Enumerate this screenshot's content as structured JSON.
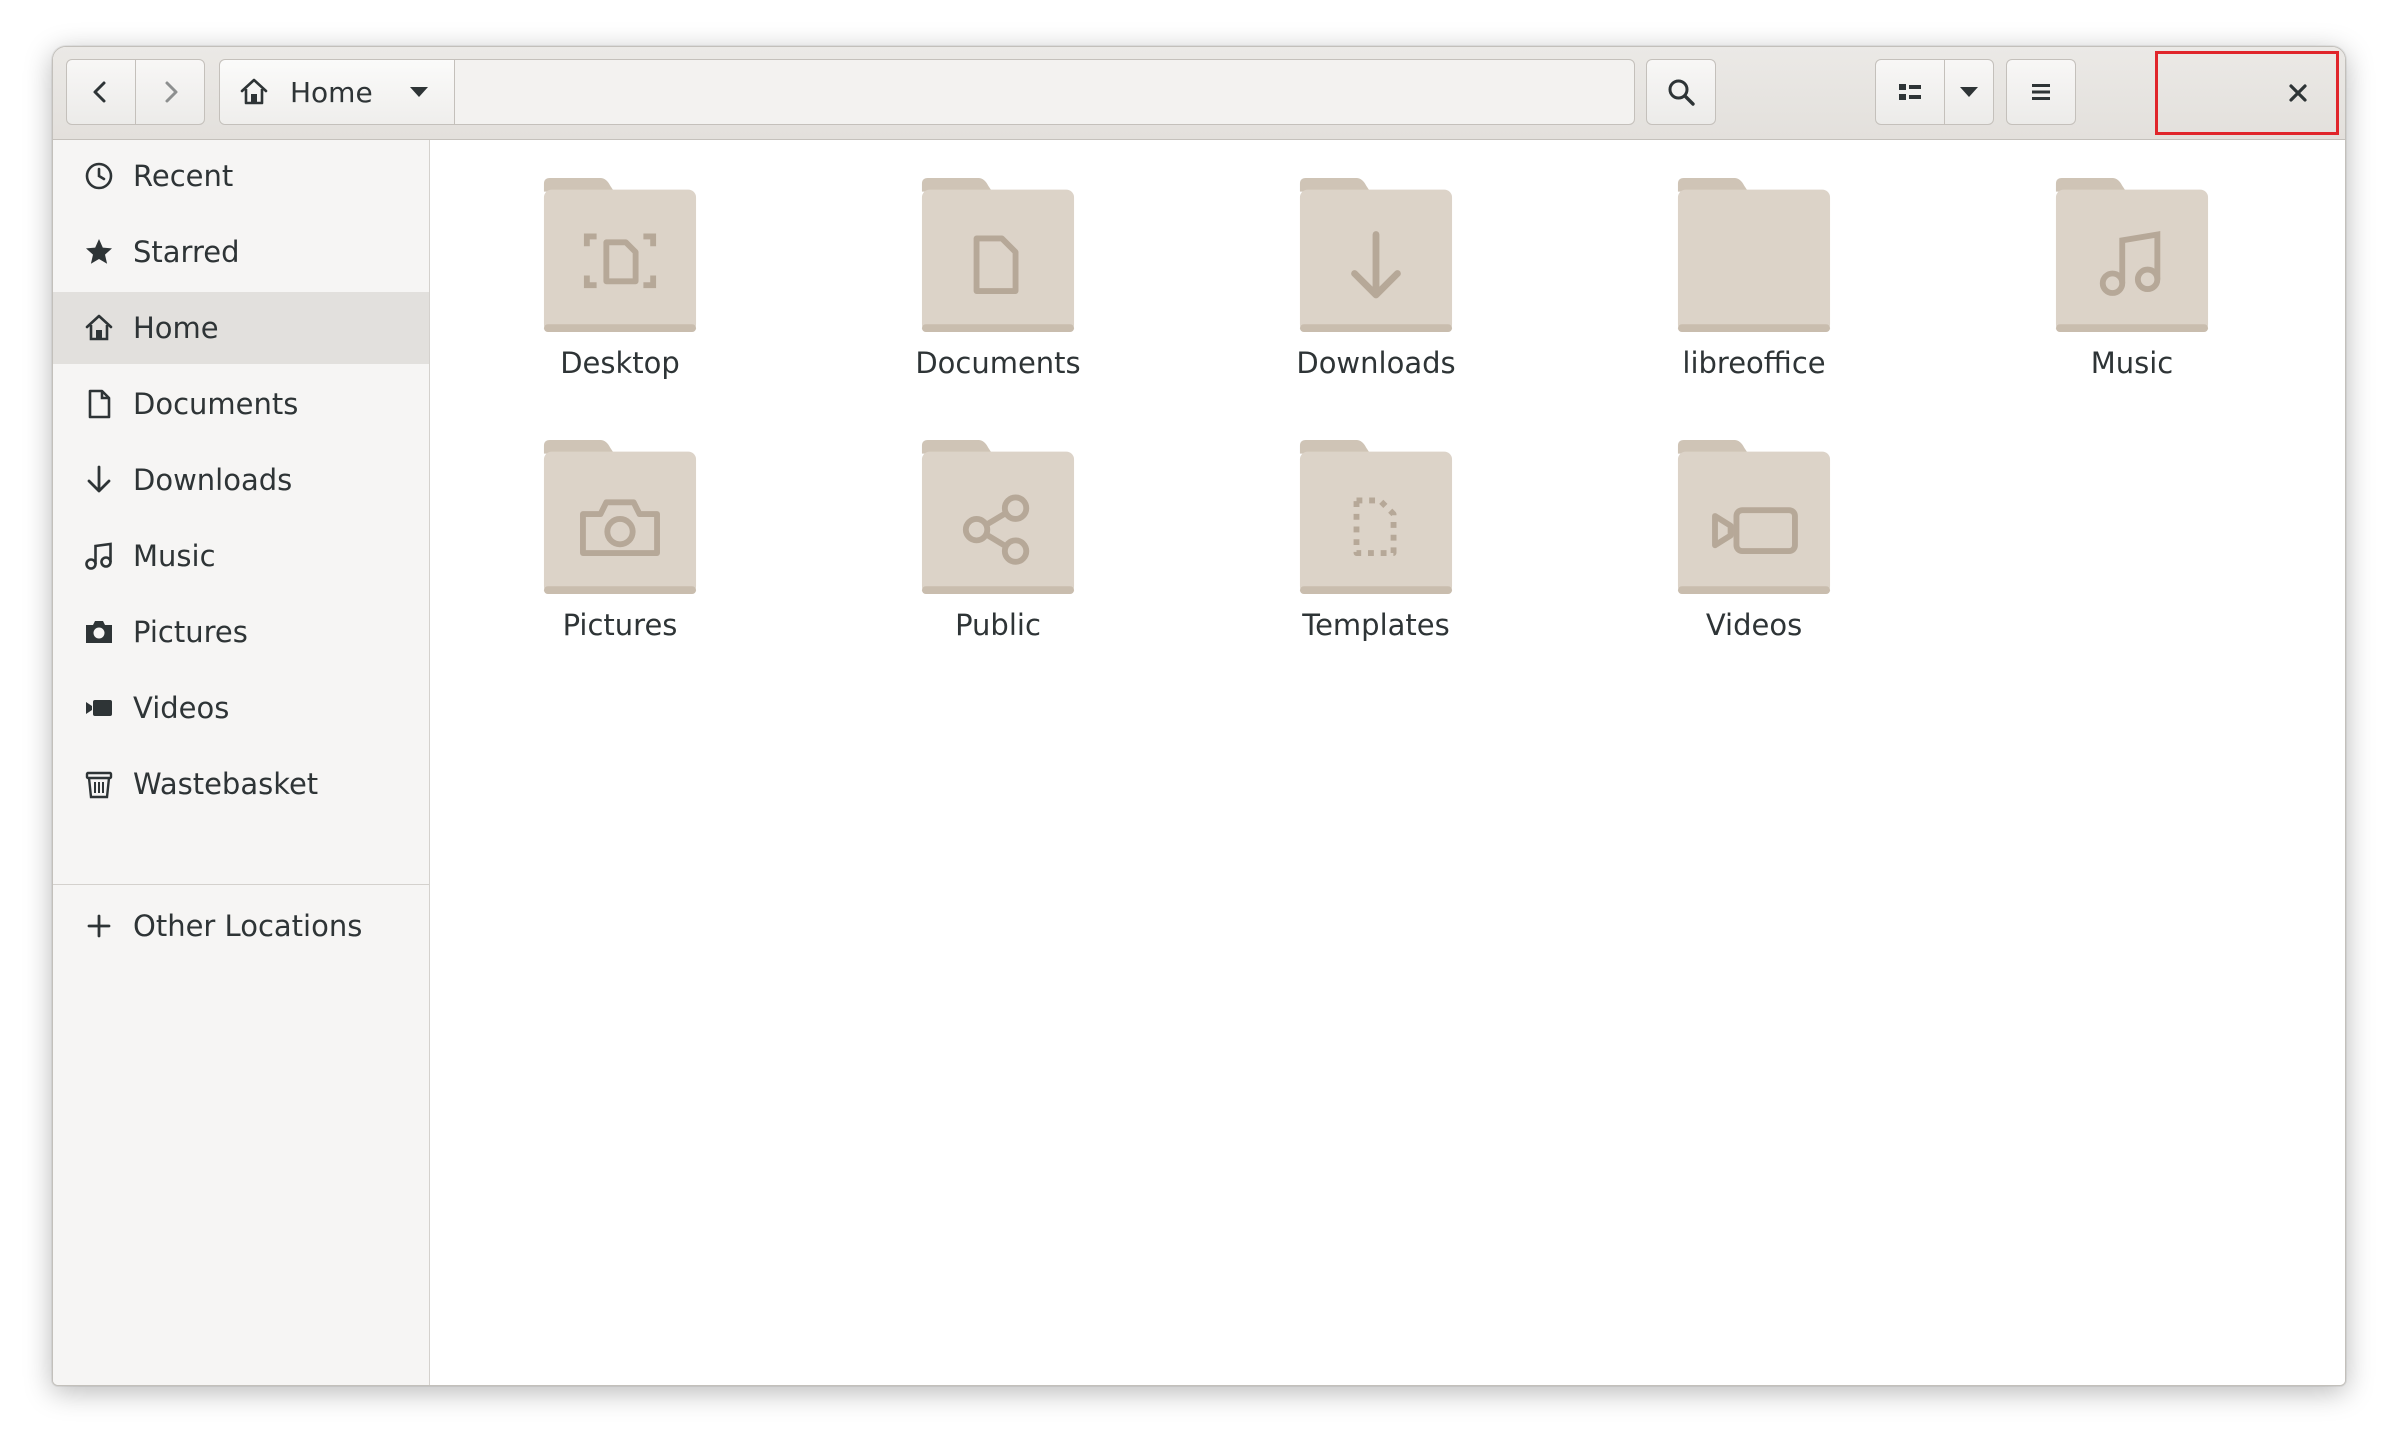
{
  "header": {
    "back_icon": "chevron-left-icon",
    "forward_icon": "chevron-right-icon",
    "path": {
      "label": "Home",
      "icon": "home-icon",
      "dropdown_icon": "triangle-down-icon"
    },
    "search_icon": "magnifier-icon",
    "view_icon": "grid-view-icon",
    "view_dropdown_icon": "triangle-down-icon",
    "menu_icon": "hamburger-icon",
    "close_icon": "close-icon"
  },
  "sidebar": {
    "items": [
      {
        "label": "Recent",
        "icon": "clock-icon"
      },
      {
        "label": "Starred",
        "icon": "star-icon"
      },
      {
        "label": "Home",
        "icon": "home-icon",
        "active": true
      },
      {
        "label": "Documents",
        "icon": "document-icon"
      },
      {
        "label": "Downloads",
        "icon": "download-arrow-icon"
      },
      {
        "label": "Music",
        "icon": "music-note-icon"
      },
      {
        "label": "Pictures",
        "icon": "camera-icon"
      },
      {
        "label": "Videos",
        "icon": "video-camera-icon"
      },
      {
        "label": "Wastebasket",
        "icon": "trash-icon"
      }
    ],
    "other": {
      "label": "Other Locations",
      "icon": "plus-icon"
    }
  },
  "files": [
    {
      "name": "Desktop",
      "icon": "desktop-folder-icon"
    },
    {
      "name": "Documents",
      "icon": "documents-folder-icon"
    },
    {
      "name": "Downloads",
      "icon": "downloads-folder-icon"
    },
    {
      "name": "libreoffice",
      "icon": "folder-icon"
    },
    {
      "name": "Music",
      "icon": "music-folder-icon"
    },
    {
      "name": "Pictures",
      "icon": "pictures-folder-icon"
    },
    {
      "name": "Public",
      "icon": "public-folder-icon"
    },
    {
      "name": "Templates",
      "icon": "templates-folder-icon"
    },
    {
      "name": "Videos",
      "icon": "videos-folder-icon"
    }
  ],
  "colors": {
    "folder": "#dcd3c8",
    "folder_tab": "#cfc4b6",
    "folder_glyph": "#b6a898",
    "highlight": "#e0252b"
  }
}
